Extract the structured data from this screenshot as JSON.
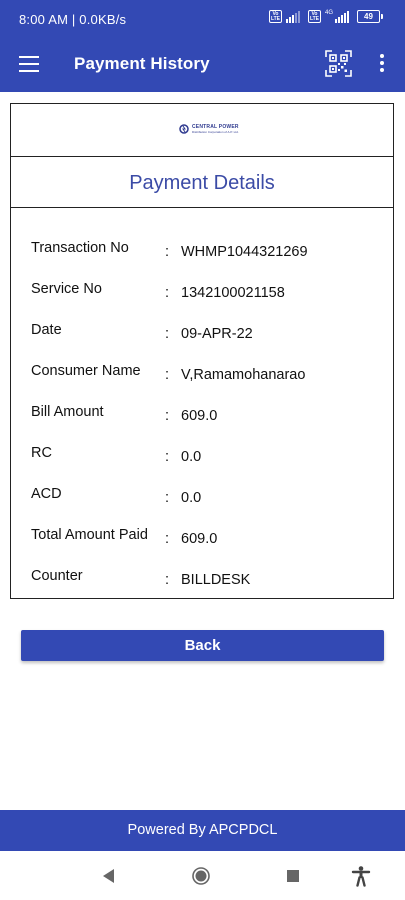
{
  "status_bar": {
    "time_text": "8:00 AM | 0.0KB/s",
    "volte_label": "Vo LTE",
    "network_label": "4G",
    "battery_level": "49"
  },
  "app_bar": {
    "title": "Payment History",
    "menu_icon": "hamburger-menu-icon",
    "qr_icon": "qr-code-scan-icon",
    "more_icon": "more-vert-icon"
  },
  "card": {
    "logo_name": "CENTRAL POWER",
    "logo_subtitle": "Distribution Corporation of A.P. Ltd.",
    "title": "Payment Details",
    "separator": ":",
    "rows": [
      {
        "label": "Transaction No",
        "value": "WHMP1044321269"
      },
      {
        "label": "Service No",
        "value": "1342100021158"
      },
      {
        "label": "Date",
        "value": "09-APR-22"
      },
      {
        "label": "Consumer Name",
        "value": "V,Ramamohanarao"
      },
      {
        "label": "Bill Amount",
        "value": "609.0"
      },
      {
        "label": "RC",
        "value": "0.0"
      },
      {
        "label": "ACD",
        "value": "0.0"
      },
      {
        "label": "Total Amount Paid",
        "value": "609.0"
      },
      {
        "label": "Counter",
        "value": "BILLDESK"
      }
    ]
  },
  "back_button_label": "Back",
  "footer_text": "Powered By APCPDCL",
  "nav_bar": {
    "back_icon": "nav-back-icon",
    "home_icon": "nav-home-icon",
    "recents_icon": "nav-recents-icon",
    "accessibility_icon": "accessibility-icon"
  },
  "colors": {
    "primary": "#3349b4",
    "title_text": "#3b4ba6",
    "border": "#222222"
  }
}
